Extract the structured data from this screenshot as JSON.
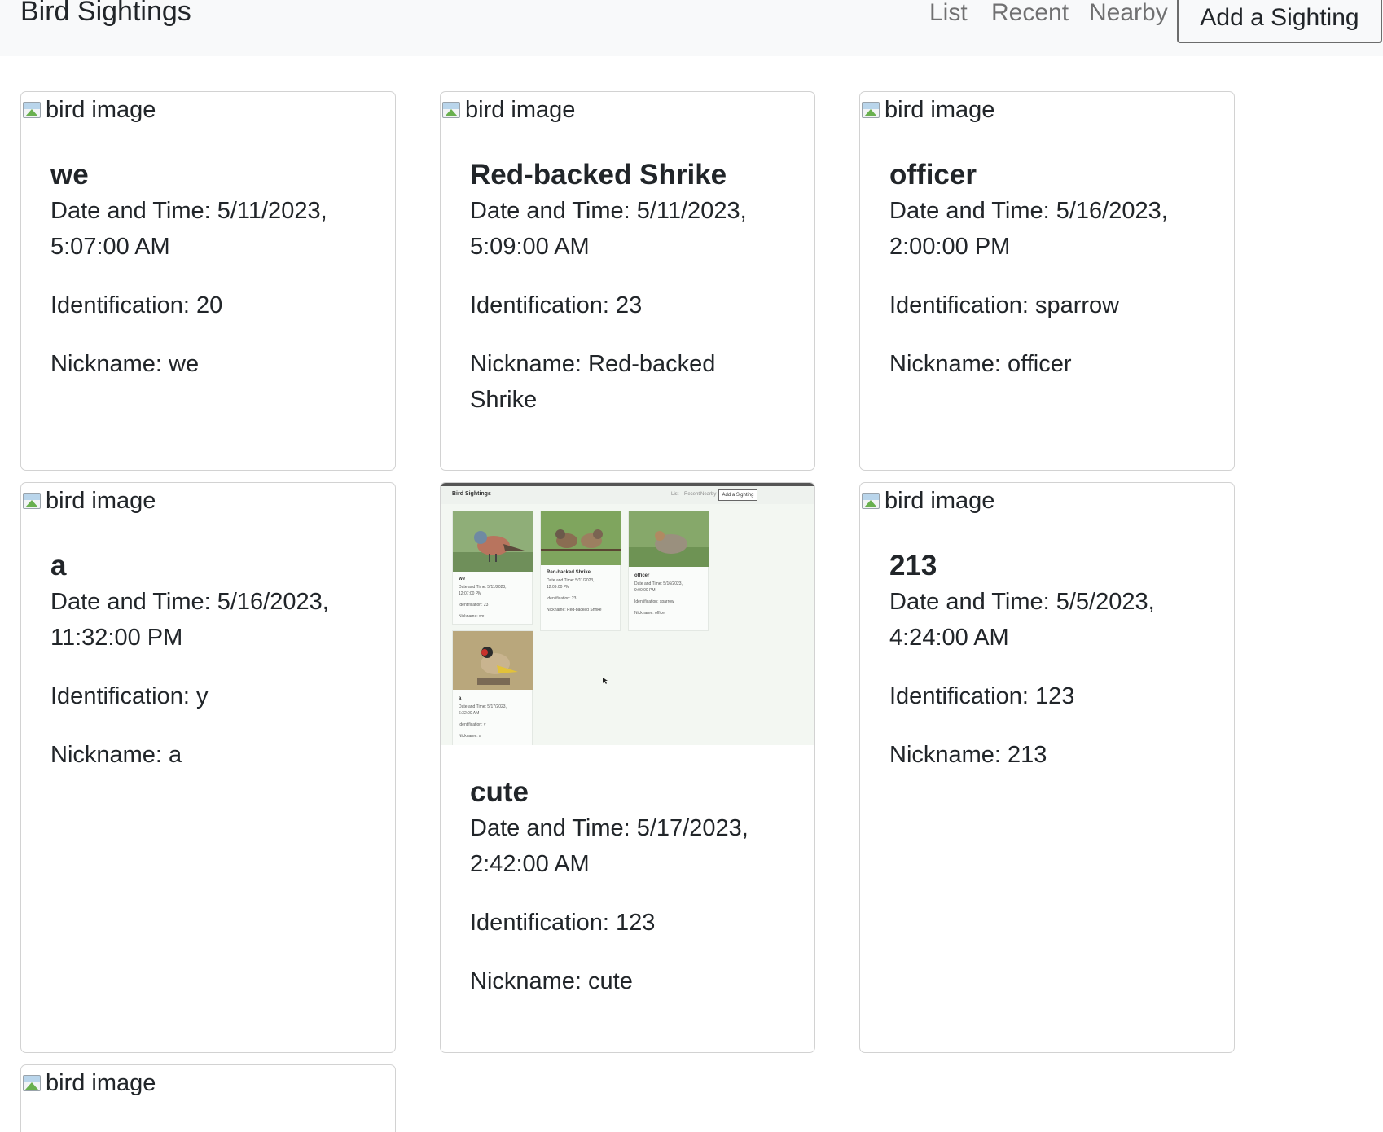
{
  "nav": {
    "brand": "Bird Sightings",
    "links": [
      "List",
      "Recent",
      "Nearby"
    ],
    "add_button": "Add a Sighting"
  },
  "image_alt": "bird image",
  "labels": {
    "date": "Date and Time:",
    "identification": "Identification:",
    "nickname": "Nickname:"
  },
  "cards": [
    {
      "title": "we",
      "date_line1": "Date and Time: 5/11/2023,",
      "date_line2": "5:07:00 AM",
      "identification": "Identification: 20",
      "nickname_line1": "Nickname: we",
      "nickname_line2": ""
    },
    {
      "title": "Red-backed Shrike",
      "date_line1": "Date and Time: 5/11/2023,",
      "date_line2": "5:09:00 AM",
      "identification": "Identification: 23",
      "nickname_line1": "Nickname: Red-backed",
      "nickname_line2": "Shrike"
    },
    {
      "title": "officer",
      "date_line1": "Date and Time: 5/16/2023,",
      "date_line2": "2:00:00 PM",
      "identification": "Identification: sparrow",
      "nickname_line1": "Nickname: officer",
      "nickname_line2": ""
    },
    {
      "title": "a",
      "date_line1": "Date and Time: 5/16/2023,",
      "date_line2": "11:32:00 PM",
      "identification": "Identification: y",
      "nickname_line1": "Nickname: a",
      "nickname_line2": ""
    },
    {
      "title": "cute",
      "date_line1": "Date and Time: 5/17/2023,",
      "date_line2": "2:42:00 AM",
      "identification": "Identification: 123",
      "nickname_line1": "Nickname: cute",
      "nickname_line2": ""
    },
    {
      "title": "213",
      "date_line1": "Date and Time: 5/5/2023,",
      "date_line2": "4:24:00 AM",
      "identification": "Identification: 123",
      "nickname_line1": "Nickname: 213",
      "nickname_line2": ""
    }
  ],
  "thumbnail": {
    "brand": "Bird Sightings",
    "links": [
      "List",
      "Recent",
      "Nearby"
    ],
    "add_button": "Add a Sighting",
    "cards": [
      {
        "title": "we",
        "lines": [
          "Date and Time: 5/11/2023,",
          "12:07:00 PM",
          "Identification: 23",
          "Nickname: we"
        ]
      },
      {
        "title": "Red-backed Shrike",
        "lines": [
          "Date and Time: 5/11/2023,",
          "12:09:00 PM",
          "Identification: 23",
          "Nickname: Red-backed Shrike"
        ]
      },
      {
        "title": "officer",
        "lines": [
          "Date and Time: 5/16/2023,",
          "9:00:00 PM",
          "Identification: sparrow",
          "Nickname: officer"
        ]
      },
      {
        "title": "a",
        "lines": [
          "Date and Time: 5/17/2023,",
          "6:32:00 AM",
          "Identification: y",
          "Nickname: a"
        ]
      }
    ]
  },
  "colors": {
    "navbar_bg": "#f8f9fa",
    "text": "#212529",
    "nav_link": "#8c8c8c",
    "card_border": "#d9d9d9"
  }
}
